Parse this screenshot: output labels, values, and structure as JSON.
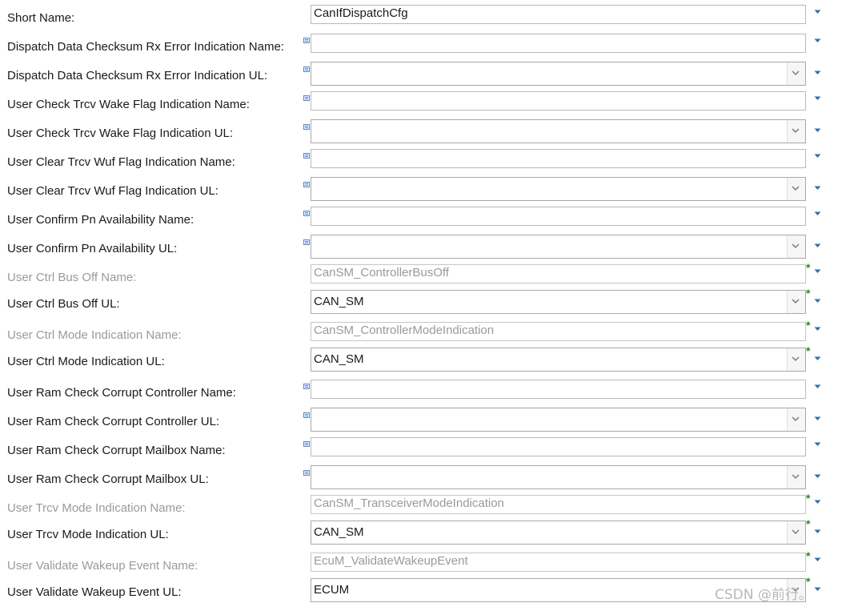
{
  "rows": [
    {
      "label": "Short Name:",
      "value": "CanIfDispatchCfg",
      "kind": "text",
      "disabled": false,
      "required": false,
      "info": false
    },
    {
      "label": "Dispatch Data Checksum Rx Error Indication Name:",
      "value": "",
      "kind": "text",
      "disabled": false,
      "required": false,
      "info": true
    },
    {
      "label": "Dispatch Data Checksum Rx Error Indication UL:",
      "value": "",
      "kind": "combo",
      "disabled": false,
      "required": false,
      "info": true
    },
    {
      "label": "User Check Trcv Wake Flag Indication Name:",
      "value": "",
      "kind": "text",
      "disabled": false,
      "required": false,
      "info": true
    },
    {
      "label": "User Check Trcv Wake Flag Indication UL:",
      "value": "",
      "kind": "combo",
      "disabled": false,
      "required": false,
      "info": true
    },
    {
      "label": "User Clear Trcv Wuf Flag Indication Name:",
      "value": "",
      "kind": "text",
      "disabled": false,
      "required": false,
      "info": true
    },
    {
      "label": "User Clear Trcv Wuf Flag Indication UL:",
      "value": "",
      "kind": "combo",
      "disabled": false,
      "required": false,
      "info": true
    },
    {
      "label": "User Confirm Pn Availability Name:",
      "value": "",
      "kind": "text",
      "disabled": false,
      "required": false,
      "info": true
    },
    {
      "label": "User Confirm Pn Availability UL:",
      "value": "",
      "kind": "combo",
      "disabled": false,
      "required": false,
      "info": true
    },
    {
      "label": "User Ctrl Bus Off Name:",
      "value": "CanSM_ControllerBusOff",
      "kind": "text",
      "disabled": true,
      "required": true,
      "info": false
    },
    {
      "label": "User Ctrl Bus Off UL:",
      "value": "CAN_SM",
      "kind": "combo",
      "disabled": false,
      "required": true,
      "info": false
    },
    {
      "label": "User Ctrl Mode Indication Name:",
      "value": "CanSM_ControllerModeIndication",
      "kind": "text",
      "disabled": true,
      "required": true,
      "info": false
    },
    {
      "label": "User Ctrl Mode Indication UL:",
      "value": "CAN_SM",
      "kind": "combo",
      "disabled": false,
      "required": true,
      "info": false
    },
    {
      "label": "User Ram Check Corrupt Controller Name:",
      "value": "",
      "kind": "text",
      "disabled": false,
      "required": false,
      "info": true
    },
    {
      "label": "User Ram Check Corrupt Controller UL:",
      "value": "",
      "kind": "combo",
      "disabled": false,
      "required": false,
      "info": true
    },
    {
      "label": "User Ram Check Corrupt Mailbox Name:",
      "value": "",
      "kind": "text",
      "disabled": false,
      "required": false,
      "info": true
    },
    {
      "label": "User Ram Check Corrupt Mailbox UL:",
      "value": "",
      "kind": "combo",
      "disabled": false,
      "required": false,
      "info": true
    },
    {
      "label": "User Trcv Mode Indication Name:",
      "value": "CanSM_TransceiverModeIndication",
      "kind": "text",
      "disabled": true,
      "required": true,
      "info": false
    },
    {
      "label": "User Trcv Mode Indication UL:",
      "value": "CAN_SM",
      "kind": "combo",
      "disabled": false,
      "required": true,
      "info": false
    },
    {
      "label": "User Validate Wakeup Event Name:",
      "value": "EcuM_ValidateWakeupEvent",
      "kind": "text",
      "disabled": true,
      "required": true,
      "info": false
    },
    {
      "label": "User Validate Wakeup Event UL:",
      "value": "ECUM",
      "kind": "combo",
      "disabled": false,
      "required": true,
      "info": false
    }
  ],
  "required_marker": "*",
  "watermark": "CSDN @前行。",
  "colors": {
    "required": "#2a8a2a",
    "dropdown_arrow": "#2f6fb3",
    "disabled_text": "#9a9a9a"
  }
}
